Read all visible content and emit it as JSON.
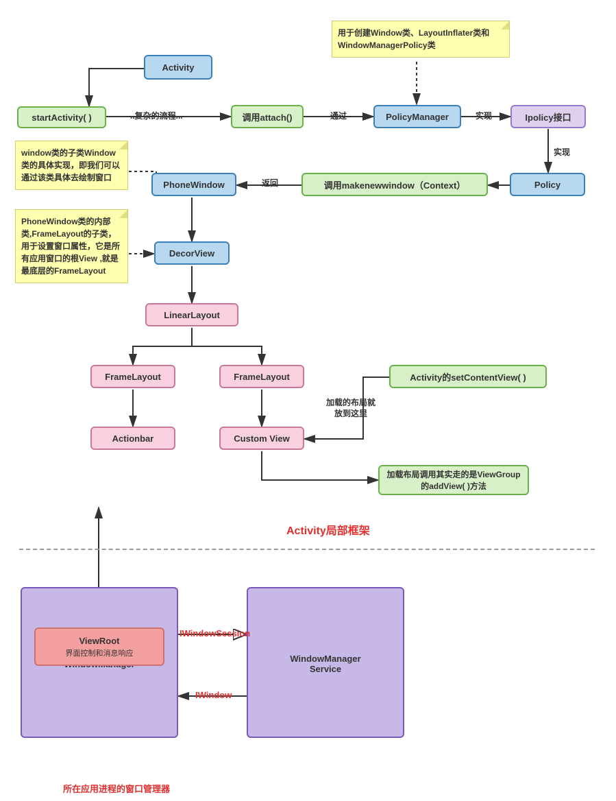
{
  "nodes": {
    "activity": "Activity",
    "startActivity": "startActivity( )",
    "attach": "调用attach()",
    "policyManager": "PolicyManager",
    "ipolicy": "Ipolicy接口",
    "policy": "Policy",
    "makenew": "调用makenewwindow（Context）",
    "phoneWindow": "PhoneWindow",
    "decorView": "DecorView",
    "linearLayout": "LinearLayout",
    "frameLayout1": "FrameLayout",
    "frameLayout2": "FrameLayout",
    "actionbar": "Actionbar",
    "customView": "Custom View",
    "setContentView": "Activity的setContentView( )",
    "addView": "加载布局调用其实走的是ViewGroup的addView( )方法",
    "windowManager": "WindowManager",
    "viewRoot": "ViewRoot",
    "viewRootSub": "界面控制和消息响应",
    "wms": "WindowManager",
    "wmsSub": "Service"
  },
  "notes": {
    "note1": "用于创建Window类、LayoutInflater类和WindowManagerPolicy类",
    "note2": "window类的子类Window类的具体实现，即我们可以通过该类具体去绘制窗口",
    "note3": "PhoneWindow类的内部类,FrameLayout的子类，用于设置窗口属性，它是所有应用窗口的根View ,就是最底层的FrameLayout"
  },
  "edges": {
    "flow": "..复杂的流程...",
    "pass": "通过",
    "impl": "实现",
    "impl2": "实现",
    "ret": "返回",
    "loadLayout": "加载的布局就放到这里"
  },
  "titles": {
    "section1": "Activity局部框架",
    "section2": "所在应用进程的窗口管理器",
    "iwindowsession": "IWindowSession",
    "iwindow": "IWindow"
  }
}
